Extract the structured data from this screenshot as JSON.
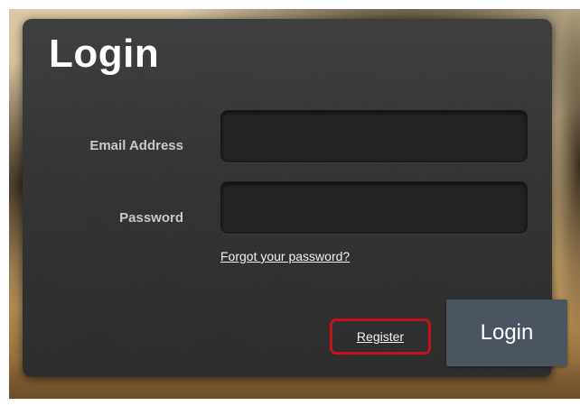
{
  "form": {
    "title": "Login",
    "email_label": "Email Address",
    "email_value": "",
    "email_placeholder": "",
    "password_label": "Password",
    "password_value": "",
    "password_placeholder": "",
    "forgot_link": "Forgot your password?",
    "register_link": "Register",
    "login_button": "Login"
  },
  "colors": {
    "panel": "#333333",
    "input_bg": "#232323",
    "button_bg": "#4b5560",
    "highlight": "#c4121a"
  }
}
